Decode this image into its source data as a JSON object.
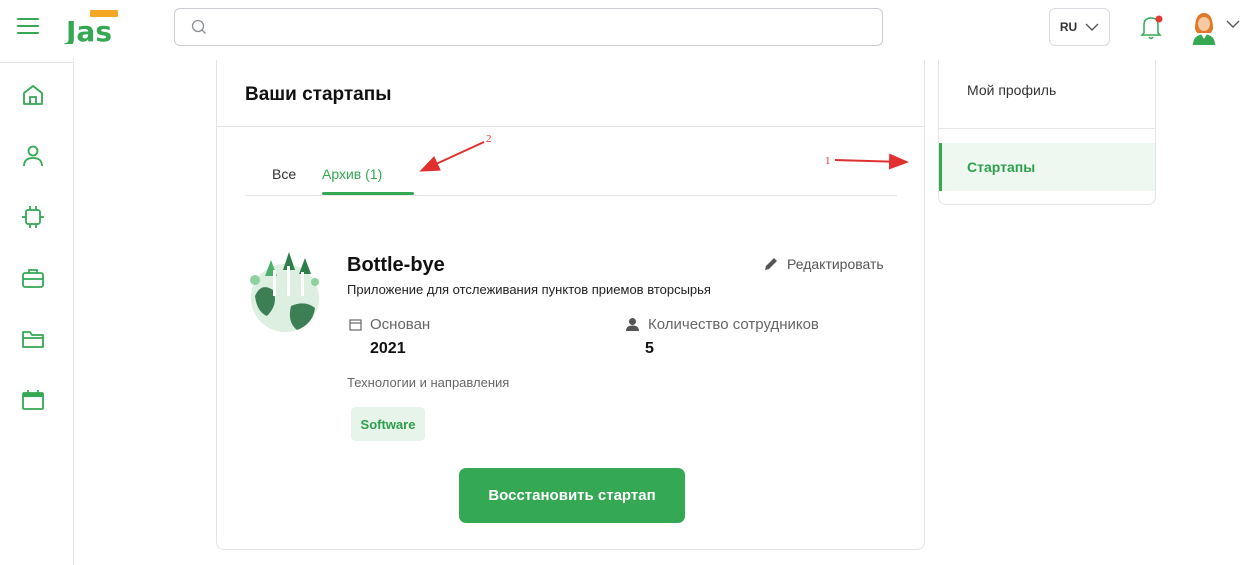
{
  "header": {
    "logo_text": "Jas",
    "search": {
      "value": "",
      "placeholder": ""
    },
    "language": "RU"
  },
  "main": {
    "title": "Ваши стартапы",
    "tabs": [
      {
        "label": "Все",
        "active": false
      },
      {
        "label": "Архив (1)",
        "active": true
      }
    ],
    "startup": {
      "name": "Bottle-bye",
      "description": "Приложение для отслеживания пунктов приемов вторсырья",
      "edit_label": "Редактировать",
      "founded_label": "Основан",
      "founded_value": "2021",
      "employees_label": "Количество сотрудников",
      "employees_value": "5",
      "tech_label": "Технологии и направления",
      "tags": [
        "Software"
      ],
      "restore_label": "Восстановить стартап"
    }
  },
  "right_menu": {
    "items": [
      {
        "label": "Мой профиль",
        "active": false
      },
      {
        "label": "Стартапы",
        "active": true
      }
    ]
  },
  "annotations": [
    "1",
    "2"
  ],
  "colors": {
    "accent": "#34a853",
    "accent_light": "#e6f4ea",
    "annotation": "#e03030"
  },
  "icons": {
    "sidebar": [
      "home-icon",
      "user-icon",
      "chip-icon",
      "briefcase-icon",
      "folder-icon",
      "calendar-icon"
    ]
  }
}
